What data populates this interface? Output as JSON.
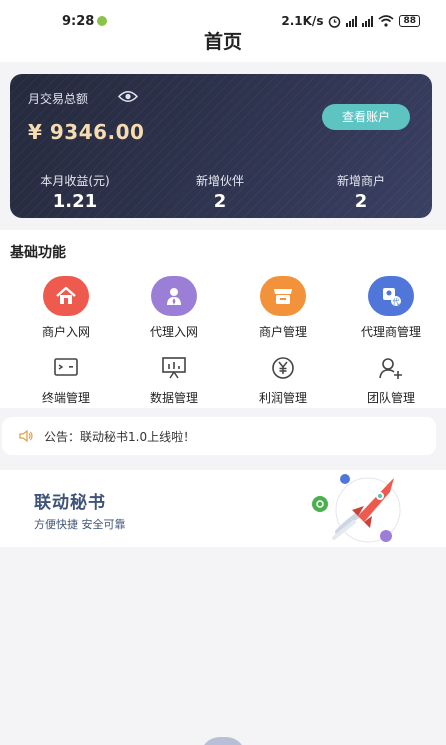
{
  "status_bar": {
    "time": "9:28",
    "speed": "2.1K/s",
    "battery": "88"
  },
  "nav": {
    "title": "首页"
  },
  "account_card": {
    "label": "月交易总额",
    "amount": "¥ 9346.00",
    "view_button": "查看账户",
    "stats": [
      {
        "label": "本月收益(元)",
        "value": "1.21"
      },
      {
        "label": "新增伙伴",
        "value": "2"
      },
      {
        "label": "新增商户",
        "value": "2"
      }
    ]
  },
  "functions": {
    "heading": "基础功能",
    "items": [
      {
        "label": "商户入网",
        "icon": "home-icon",
        "color": "#ee5a4d"
      },
      {
        "label": "代理入网",
        "icon": "person-icon",
        "color": "#9b7fd6"
      },
      {
        "label": "商户管理",
        "icon": "shop-icon",
        "color": "#f2923a"
      },
      {
        "label": "代理商管理",
        "icon": "agent-icon",
        "color": "#4f76d8"
      },
      {
        "label": "终端管理",
        "icon": "terminal-icon"
      },
      {
        "label": "数据管理",
        "icon": "chart-board-icon"
      },
      {
        "label": "利润管理",
        "icon": "yen-coin-icon"
      },
      {
        "label": "团队管理",
        "icon": "team-add-icon"
      }
    ]
  },
  "notice": {
    "text": "公告：联动秘书1.0上线啦！"
  },
  "banner": {
    "title": "联动秘书",
    "subtitle": "方便快捷  安全可靠"
  }
}
